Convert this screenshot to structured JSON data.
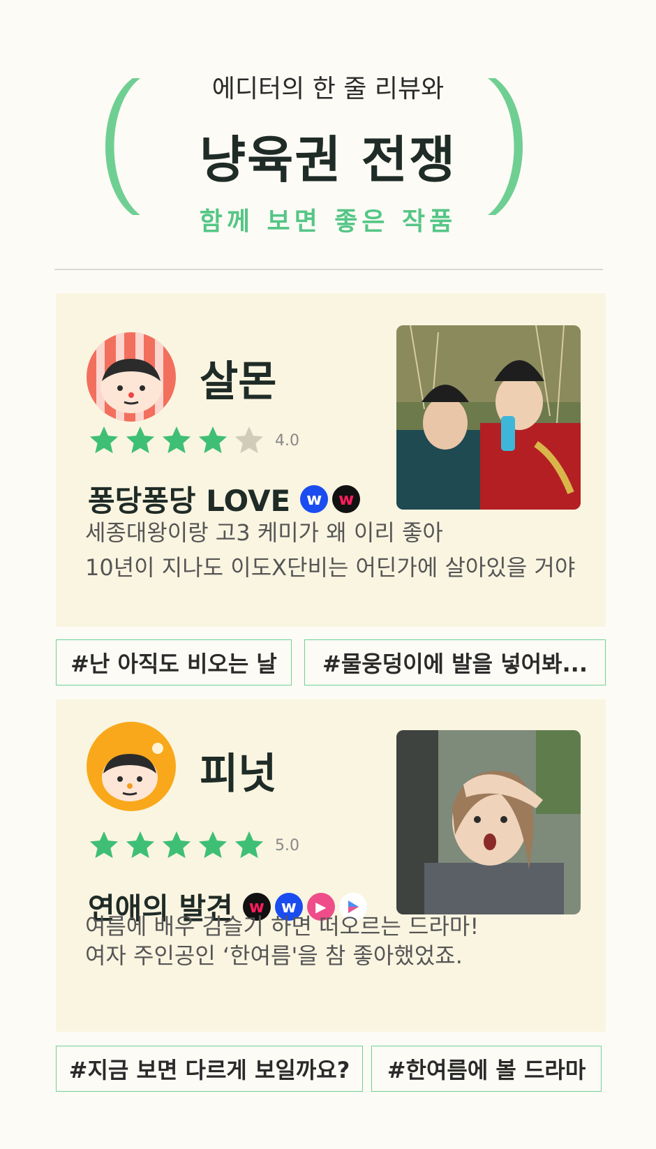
{
  "header": {
    "subtitle": "에디터의 한 줄 리뷰와",
    "title": "냥육권 전쟁",
    "tagline": "함께 보면 좋은 작품"
  },
  "reviews": [
    {
      "reviewer": "살몬",
      "rating": "4.0",
      "stars_filled": 4,
      "work_title": "퐁당퐁당 LOVE",
      "services": [
        "wavve-icon",
        "watcha-icon"
      ],
      "comment_lines": [
        "세종대왕이랑 고3 케미가 왜 이리 좋아",
        "10년이 지나도 이도X단비는 어딘가에 살아있을 거야"
      ],
      "avatar_color": "#f26f5d",
      "tags": [
        "#난 아직도 비오는 날",
        "#물웅덩이에 발을 넣어봐..."
      ]
    },
    {
      "reviewer": "피넛",
      "rating": "5.0",
      "stars_filled": 5,
      "work_title": "연애의 발견",
      "services": [
        "watcha-icon",
        "wavve-icon",
        "tving-icon",
        "google-play-icon"
      ],
      "comment_lines": [
        "여름에 배우 김슬기 하면 떠오르는 드라마!",
        "여자 주인공인 ‘한여름'을 참 좋아했었죠."
      ],
      "avatar_color": "#f9a81b",
      "tags": [
        "#지금 보면 다르게 보일까요?",
        "#한여름에 볼 드라마"
      ]
    }
  ],
  "colors": {
    "accent": "#6fcf93",
    "star": "#3fbf75",
    "star_empty": "#cfcdb9",
    "card_bg": "#faf5e1"
  }
}
